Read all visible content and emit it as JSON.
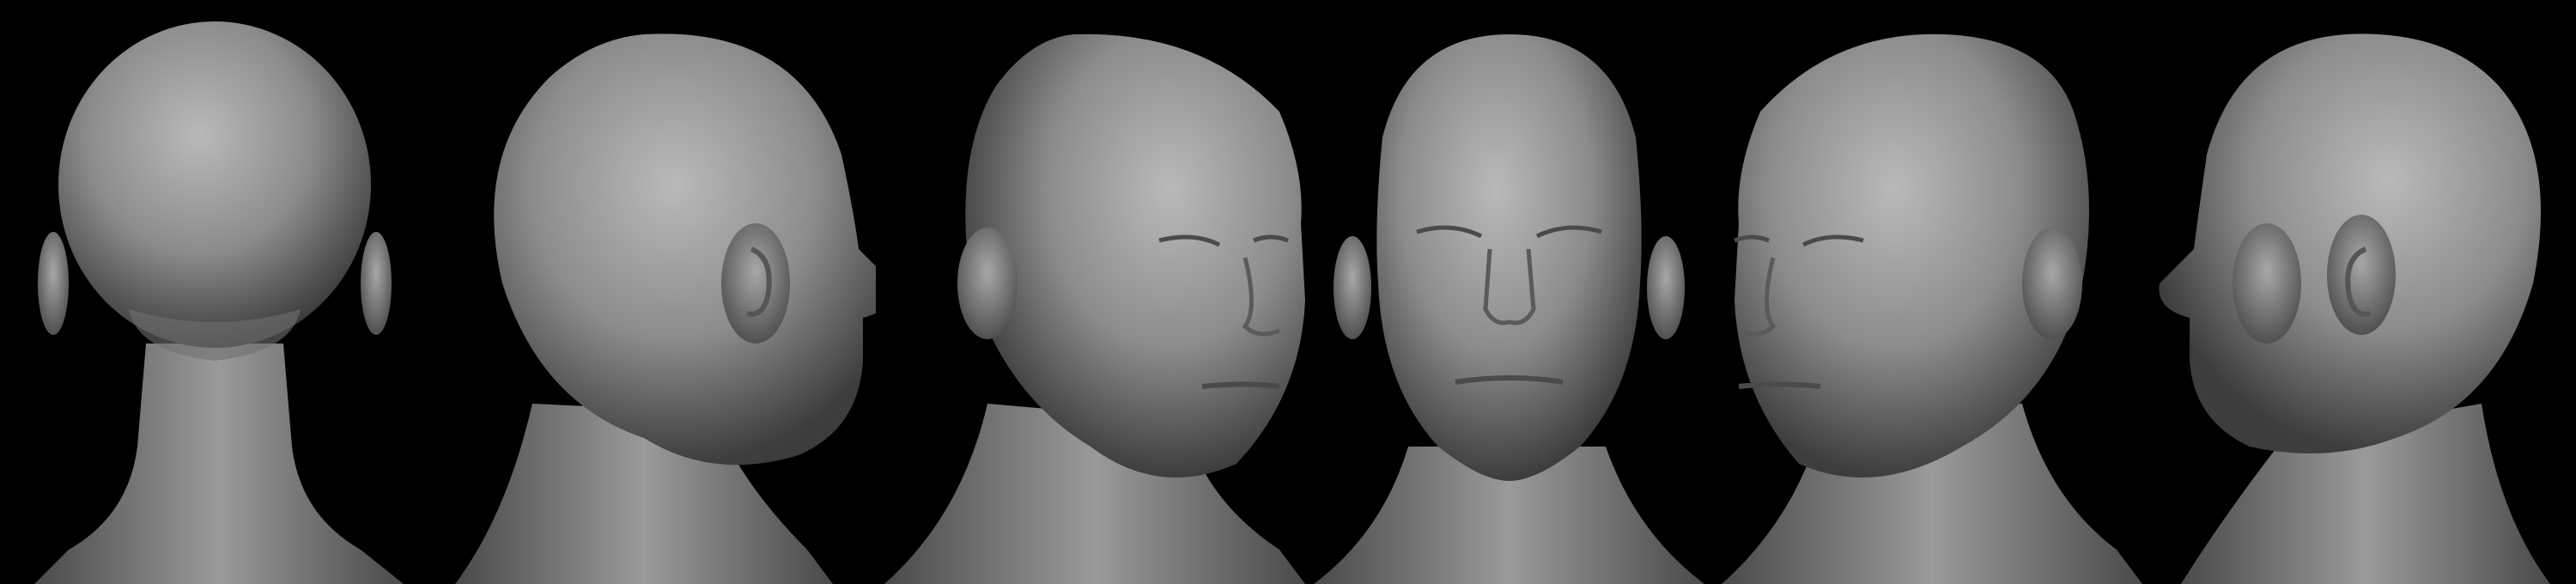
{
  "scene": {
    "background_color": "#000000",
    "clay_color": "#8f8f8f",
    "views": [
      {
        "id": "back",
        "icon": "head-back-view"
      },
      {
        "id": "right-profile",
        "icon": "head-right-profile-view"
      },
      {
        "id": "three-quarter-right",
        "icon": "head-three-quarter-right-view"
      },
      {
        "id": "front",
        "icon": "head-front-view"
      },
      {
        "id": "three-quarter-left",
        "icon": "head-three-quarter-left-view"
      },
      {
        "id": "left-profile",
        "icon": "head-left-profile-view"
      }
    ]
  }
}
